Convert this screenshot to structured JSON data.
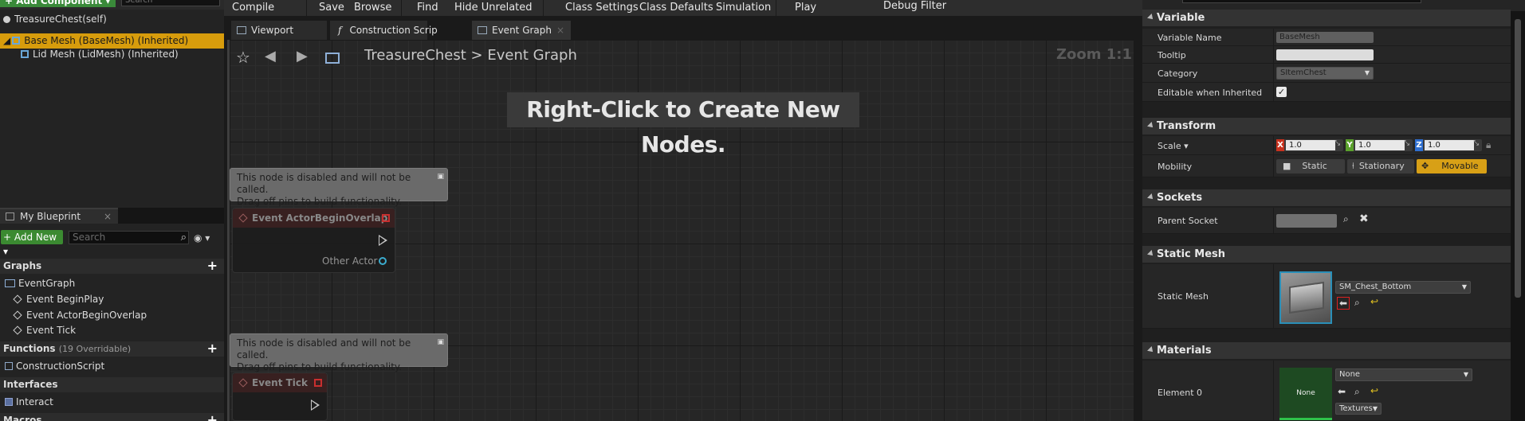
{
  "components": {
    "add_component": "+ Add Component ▾",
    "search_placeholder": "Search",
    "root": "TreasureChest(self)",
    "items": [
      {
        "label": "Base Mesh (BaseMesh) (Inherited)"
      },
      {
        "label": "Lid Mesh (LidMesh) (Inherited)"
      }
    ]
  },
  "my_blueprint": {
    "tab": "My Blueprint",
    "add_new": "+ Add New",
    "search_placeholder": "Search",
    "graphs_label": "Graphs",
    "event_graph": "EventGraph",
    "events": [
      "Event BeginPlay",
      "Event ActorBeginOverlap",
      "Event Tick"
    ],
    "functions_label": "Functions",
    "functions_sub": "(19 Overridable)",
    "construction_script": "ConstructionScript",
    "interfaces_label": "Interfaces",
    "interact": "Interact",
    "macros_label": "Macros"
  },
  "toolbar": {
    "compile": "Compile",
    "save": "Save",
    "browse": "Browse",
    "find": "Find",
    "hide_unrelated": "Hide Unrelated",
    "class_settings": "Class Settings",
    "class_defaults": "Class Defaults",
    "simulation": "Simulation",
    "play": "Play",
    "debug_filter": "Debug Filter"
  },
  "tabs": {
    "viewport": "Viewport",
    "construction": "Construction Scrip",
    "event_graph": "Event Graph"
  },
  "graph": {
    "breadcrumb_root": "TreasureChest",
    "breadcrumb_sep": ">",
    "breadcrumb_current": "Event Graph",
    "zoom": "Zoom 1:1",
    "hint": "Right-Click to Create New Nodes.",
    "disabled_line1": "This node is disabled and will not be called.",
    "disabled_line2": "Drag off pins to build functionality.",
    "node1_title": "Event ActorBeginOverlap",
    "node1_pin": "Other Actor",
    "node2_title": "Event Tick"
  },
  "details": {
    "variable_section": "Variable",
    "variable_name_label": "Variable Name",
    "variable_name_value": "BaseMesh",
    "tooltip_label": "Tooltip",
    "tooltip_value": "",
    "category_label": "Category",
    "category_value": "SItemChest",
    "editable_label": "Editable when Inherited",
    "editable_checked": true,
    "transform_section": "Transform",
    "scale_label": "Scale ▾",
    "scale_x": "1.0",
    "scale_y": "1.0",
    "scale_z": "1.0",
    "axis_x": "X",
    "axis_y": "Y",
    "axis_z": "Z",
    "mobility_label": "Mobility",
    "mobility_static": "Static",
    "mobility_stationary": "Stationary",
    "mobility_movable": "Movable",
    "sockets_section": "Sockets",
    "parent_socket_label": "Parent Socket",
    "static_mesh_section": "Static Mesh",
    "static_mesh_label": "Static Mesh",
    "static_mesh_value": "SM_Chest_Bottom",
    "materials_section": "Materials",
    "element0_label": "Element 0",
    "element0_value": "None",
    "mat_thumb_label": "None",
    "textures_label": "Textures"
  },
  "colors": {
    "selection": "#d79c0c",
    "add_green": "#3b8a31",
    "movable": "#d8a016"
  }
}
